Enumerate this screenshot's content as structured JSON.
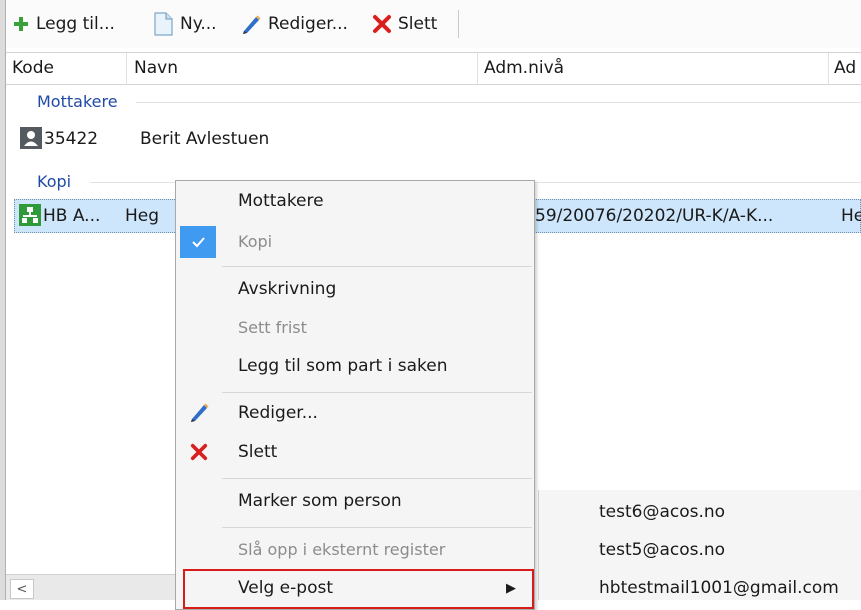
{
  "toolbar": {
    "add_label": "Legg til...",
    "new_label": "Ny...",
    "edit_label": "Rediger...",
    "delete_label": "Slett"
  },
  "columns": {
    "code": "Kode",
    "name": "Navn",
    "adm_level": "Adm.nivå",
    "partial": "Ad"
  },
  "groups": {
    "recipients": "Mottakere",
    "copy": "Kopi"
  },
  "rows": {
    "recipient": {
      "code": "35422",
      "name": "Berit Avlestuen"
    },
    "copy": {
      "code": "HB A...",
      "name": "Heg",
      "adm_level": "59/20076/20202/UR-K/A-K...",
      "extra": "He"
    }
  },
  "context_menu": {
    "recipients": "Mottakere",
    "copy": "Kopi",
    "write_off": "Avskrivning",
    "set_deadline": "Sett frist",
    "add_as_party": "Legg til som part i saken",
    "edit": "Rediger...",
    "delete": "Slett",
    "mark_as_person": "Marker som person",
    "lookup_external": "Slå opp i eksternt register",
    "choose_email": "Velg e-post",
    "submenu_arrow": "▶"
  },
  "email_submenu": [
    "test6@acos.no",
    "test5@acos.no",
    "hbtestmail1001@gmail.com"
  ],
  "scrollbar": {
    "left_arrow": "<"
  },
  "colors": {
    "group_header": "#1f4aa6",
    "selection": "#cde6fb",
    "checked_bg": "#3f9af0",
    "highlight_border": "#d81b1b"
  }
}
